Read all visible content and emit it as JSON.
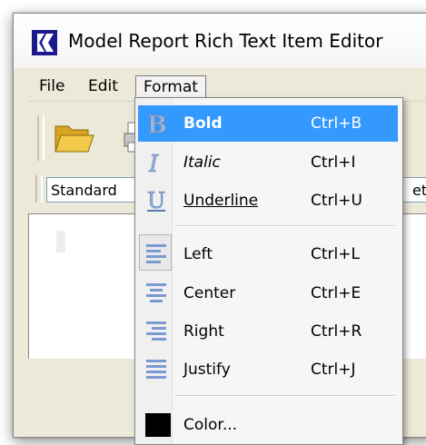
{
  "window": {
    "title": "Model Report Rich Text Item Editor"
  },
  "menubar": {
    "items": [
      "File",
      "Edit",
      "Format"
    ]
  },
  "format_bar": {
    "style_value": "Standard",
    "right_value": "etic"
  },
  "format_menu": {
    "items": [
      {
        "label": "Bold",
        "shortcut": "Ctrl+B"
      },
      {
        "label": "Italic",
        "shortcut": "Ctrl+I"
      },
      {
        "label": "Underline",
        "shortcut": "Ctrl+U"
      },
      {
        "label": "Left",
        "shortcut": "Ctrl+L"
      },
      {
        "label": "Center",
        "shortcut": "Ctrl+E"
      },
      {
        "label": "Right",
        "shortcut": "Ctrl+R"
      },
      {
        "label": "Justify",
        "shortcut": "Ctrl+J"
      },
      {
        "label": "Color...",
        "shortcut": ""
      }
    ]
  },
  "colors": {
    "highlight": "#3399ff",
    "icon_blue": "#6a8fc0",
    "color_swatch": "#000000"
  }
}
